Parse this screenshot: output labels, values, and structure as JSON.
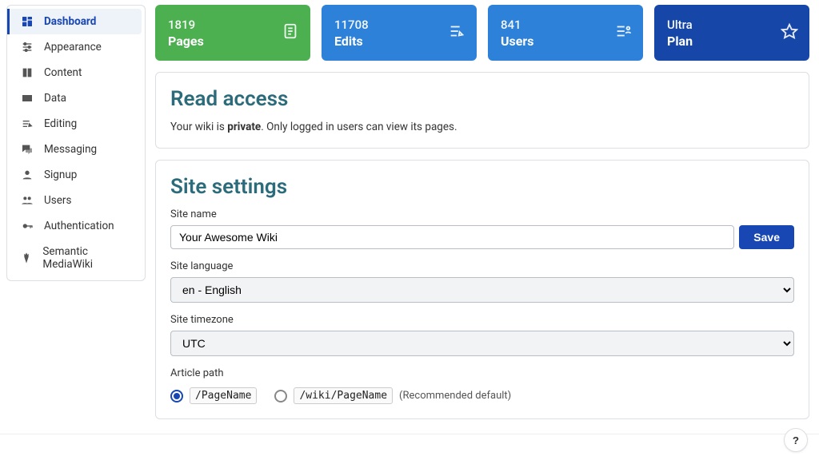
{
  "sidebar": {
    "items": [
      {
        "icon": "dashboard",
        "label": "Dashboard",
        "active": true
      },
      {
        "icon": "appearance",
        "label": "Appearance"
      },
      {
        "icon": "content",
        "label": "Content"
      },
      {
        "icon": "data",
        "label": "Data"
      },
      {
        "icon": "editing",
        "label": "Editing"
      },
      {
        "icon": "messaging",
        "label": "Messaging"
      },
      {
        "icon": "signup",
        "label": "Signup"
      },
      {
        "icon": "users",
        "label": "Users"
      },
      {
        "icon": "auth",
        "label": "Authentication"
      },
      {
        "icon": "semantic",
        "label": "Semantic MediaWiki"
      }
    ]
  },
  "stats": {
    "pages": {
      "value": "1819",
      "label": "Pages"
    },
    "edits": {
      "value": "11708",
      "label": "Edits"
    },
    "users": {
      "value": "841",
      "label": "Users"
    },
    "plan": {
      "value": "Ultra",
      "label": "Plan"
    }
  },
  "read_access": {
    "heading": "Read access",
    "prefix": "Your wiki is ",
    "bold": "private",
    "suffix": ". Only logged in users can view its pages."
  },
  "site_settings": {
    "heading": "Site settings",
    "name_label": "Site name",
    "name_value": "Your Awesome Wiki",
    "save_label": "Save",
    "lang_label": "Site language",
    "lang_value": "en - English",
    "tz_label": "Site timezone",
    "tz_value": "UTC",
    "path_label": "Article path",
    "path_options": [
      {
        "value": "/PageName",
        "checked": true
      },
      {
        "value": "/wiki/PageName",
        "checked": false
      }
    ],
    "path_hint": "(Recommended default)"
  },
  "help": "?"
}
